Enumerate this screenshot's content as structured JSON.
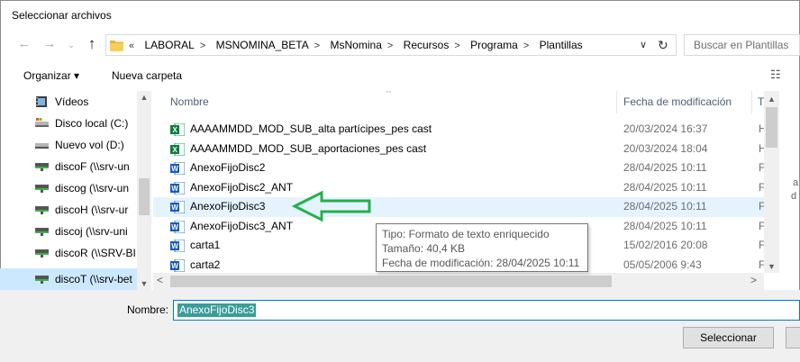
{
  "window": {
    "title": "Seleccionar archivos"
  },
  "nav": {
    "back_icon": "arrow-left-icon",
    "forward_icon": "arrow-right-icon",
    "up_icon": "arrow-up-icon",
    "breadcrumb_prefix": "«",
    "breadcrumbs": [
      "LABORAL",
      "MSNOMINA_BETA",
      "MsNomina",
      "Recursos",
      "Programa",
      "Plantillas"
    ],
    "search_placeholder": "Buscar en Plantillas"
  },
  "toolbar": {
    "organize_label": "Organizar ▾",
    "new_folder_label": "Nueva carpeta"
  },
  "sidebar": {
    "items": [
      {
        "label": "Vídeos",
        "icon": "video-folder-icon"
      },
      {
        "label": "Disco local (C:)",
        "icon": "local-drive-icon"
      },
      {
        "label": "Nuevo vol (D:)",
        "icon": "drive-icon"
      },
      {
        "label": "discoF (\\\\srv-un",
        "icon": "network-drive-icon"
      },
      {
        "label": "discog (\\\\srv-un",
        "icon": "network-drive-icon"
      },
      {
        "label": "discoH (\\\\srv-ur",
        "icon": "network-drive-icon"
      },
      {
        "label": "discoj (\\\\srv-uni",
        "icon": "network-drive-icon"
      },
      {
        "label": "discoR (\\\\SRV-BI",
        "icon": "network-drive-icon"
      },
      {
        "label": "discoT (\\\\srv-bet",
        "icon": "network-drive-icon",
        "selected": true
      }
    ]
  },
  "columns": {
    "name": "Nombre",
    "date": "Fecha de modificación",
    "type": "T"
  },
  "files": [
    {
      "name": "AAAAMMDD_MOD_SUB_alta partícipes_pes cast",
      "date": "20/03/2024 16:37",
      "type": "H",
      "icon": "excel-file-icon"
    },
    {
      "name": "AAAAMMDD_MOD_SUB_aportaciones_pes cast",
      "date": "20/03/2024 18:04",
      "type": "H",
      "icon": "excel-file-icon"
    },
    {
      "name": "AnexoFijoDisc2",
      "date": "28/04/2025 10:11",
      "type": "F",
      "icon": "word-file-icon"
    },
    {
      "name": "AnexoFijoDisc2_ANT",
      "date": "28/04/2025 10:11",
      "type": "F",
      "icon": "word-file-icon"
    },
    {
      "name": "AnexoFijoDisc3",
      "date": "28/04/2025 10:11",
      "type": "F",
      "icon": "word-file-icon",
      "hover": true
    },
    {
      "name": "AnexoFijoDisc3_ANT",
      "date": "28/04/2025 10:11",
      "type": "F",
      "icon": "word-file-icon"
    },
    {
      "name": "carta1",
      "date": "15/02/2016 20:08",
      "type": "F",
      "icon": "word-file-icon"
    },
    {
      "name": "carta2",
      "date": "05/05/2006 9:43",
      "type": "F",
      "icon": "word-file-icon"
    }
  ],
  "tooltip": {
    "type_line": "Tipo: Formato de texto enriquecido",
    "size_line": "Tamaño: 40,4 KB",
    "date_line": "Fecha de modificación: 28/04/2025 10:11"
  },
  "preview_text": {
    "line1": "a",
    "line2": "d"
  },
  "footer": {
    "name_label": "Nombre:",
    "name_value": "AnexoFijoDisc3",
    "select_button": "Seleccionar"
  },
  "colors": {
    "selection": "#cce8ff",
    "hover": "#e5f3ff",
    "annotation_arrow": "#22b14c",
    "input_focus": "#0078d7",
    "filename_highlight": "#3a9c9b"
  }
}
